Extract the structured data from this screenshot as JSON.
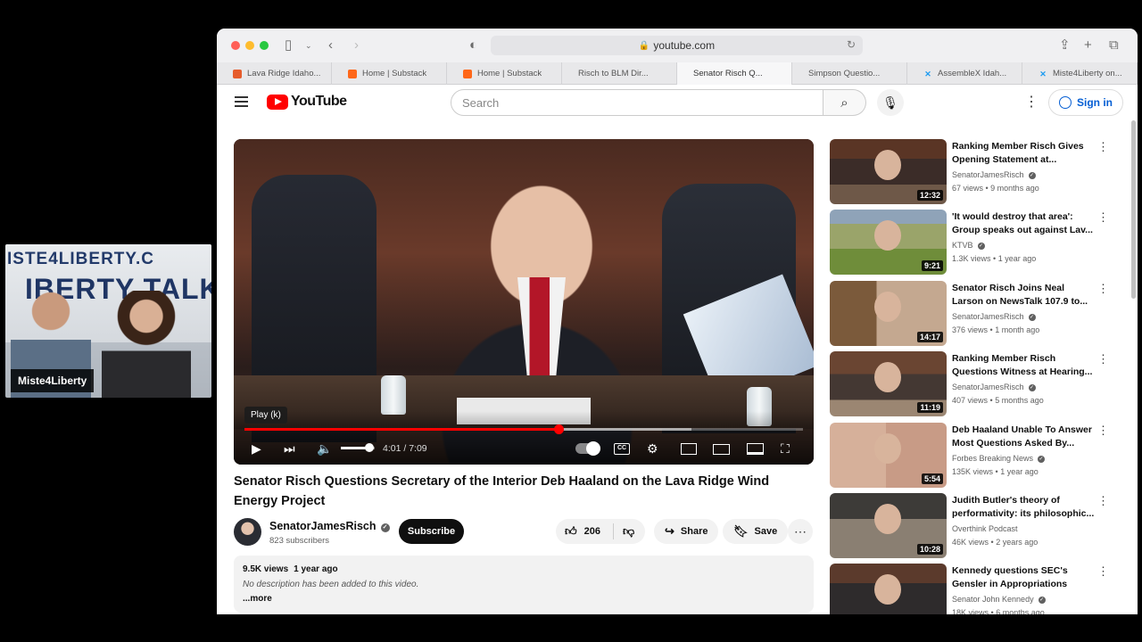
{
  "webcam": {
    "banner_top": "ISTE4LIBERTY.C",
    "banner_main": "IBERTY TALK",
    "name": "Miste4Liberty"
  },
  "browser": {
    "url": "youtube.com",
    "tabs": [
      {
        "label": "Lava Ridge Idaho...",
        "favicon": "lr"
      },
      {
        "label": "Home | Substack",
        "favicon": "ss"
      },
      {
        "label": "Home | Substack",
        "favicon": "ss"
      },
      {
        "label": "Risch to BLM Dir...",
        "favicon": "yt"
      },
      {
        "label": "Senator Risch Q...",
        "favicon": "yt",
        "active": true
      },
      {
        "label": "Simpson Questio...",
        "favicon": "yt"
      },
      {
        "label": "AssembleX Idah...",
        "favicon": "x"
      },
      {
        "label": "Miste4Liberty on...",
        "favicon": "x"
      }
    ]
  },
  "youtube": {
    "logo_text": "YouTube",
    "search_placeholder": "Search",
    "signin_label": "Sign in"
  },
  "player": {
    "tooltip": "Play (k)",
    "time": "4:01 / 7:09",
    "progress_fraction": 0.562,
    "buffered_fraction": 0.8,
    "volume_fraction": 0.85
  },
  "video": {
    "title": "Senator Risch Questions Secretary of the Interior Deb Haaland on the Lava Ridge Wind Energy Project",
    "channel": "SenatorJamesRisch",
    "subscribers": "823 subscribers",
    "subscribe_label": "Subscribe",
    "likes": "206",
    "share_label": "Share",
    "save_label": "Save",
    "views": "9.5K views",
    "date": "1 year ago",
    "description": "No description has been added to this video.",
    "more_label": "...more"
  },
  "recommendations": [
    {
      "title": "Ranking Member Risch Gives Opening Statement at...",
      "channel": "SenatorJamesRisch",
      "verified": true,
      "views": "67 views",
      "age": "9 months ago",
      "duration": "12:32",
      "thumb": "th-senate"
    },
    {
      "title": "'It would destroy that area': Group speaks out against Lav...",
      "channel": "KTVB",
      "verified": true,
      "views": "1.3K views",
      "age": "1 year ago",
      "duration": "9:21",
      "thumb": "th-field"
    },
    {
      "title": "Senator Risch Joins Neal Larson on NewsTalk 107.9 to...",
      "channel": "SenatorJamesRisch",
      "verified": true,
      "views": "376 views",
      "age": "1 month ago",
      "duration": "14:17",
      "thumb": "th-news"
    },
    {
      "title": "Ranking Member Risch Questions Witness at Hearing...",
      "channel": "SenatorJamesRisch",
      "verified": true,
      "views": "407 views",
      "age": "5 months ago",
      "duration": "11:19",
      "thumb": "th-hearing"
    },
    {
      "title": "Deb Haaland Unable To Answer Most Questions Asked By...",
      "channel": "Forbes Breaking News",
      "verified": true,
      "views": "135K views",
      "age": "1 year ago",
      "duration": "5:54",
      "thumb": "th-haaland"
    },
    {
      "title": "Judith Butler's theory of performativity: its philosophic...",
      "channel": "Overthink Podcast",
      "verified": false,
      "views": "46K views",
      "age": "2 years ago",
      "duration": "10:28",
      "thumb": "th-butler"
    },
    {
      "title": "Kennedy questions SEC's Gensler in Appropriations",
      "channel": "Senator John Kennedy",
      "verified": true,
      "views": "18K views",
      "age": "6 months ago",
      "duration": "",
      "thumb": "th-kennedy"
    }
  ]
}
